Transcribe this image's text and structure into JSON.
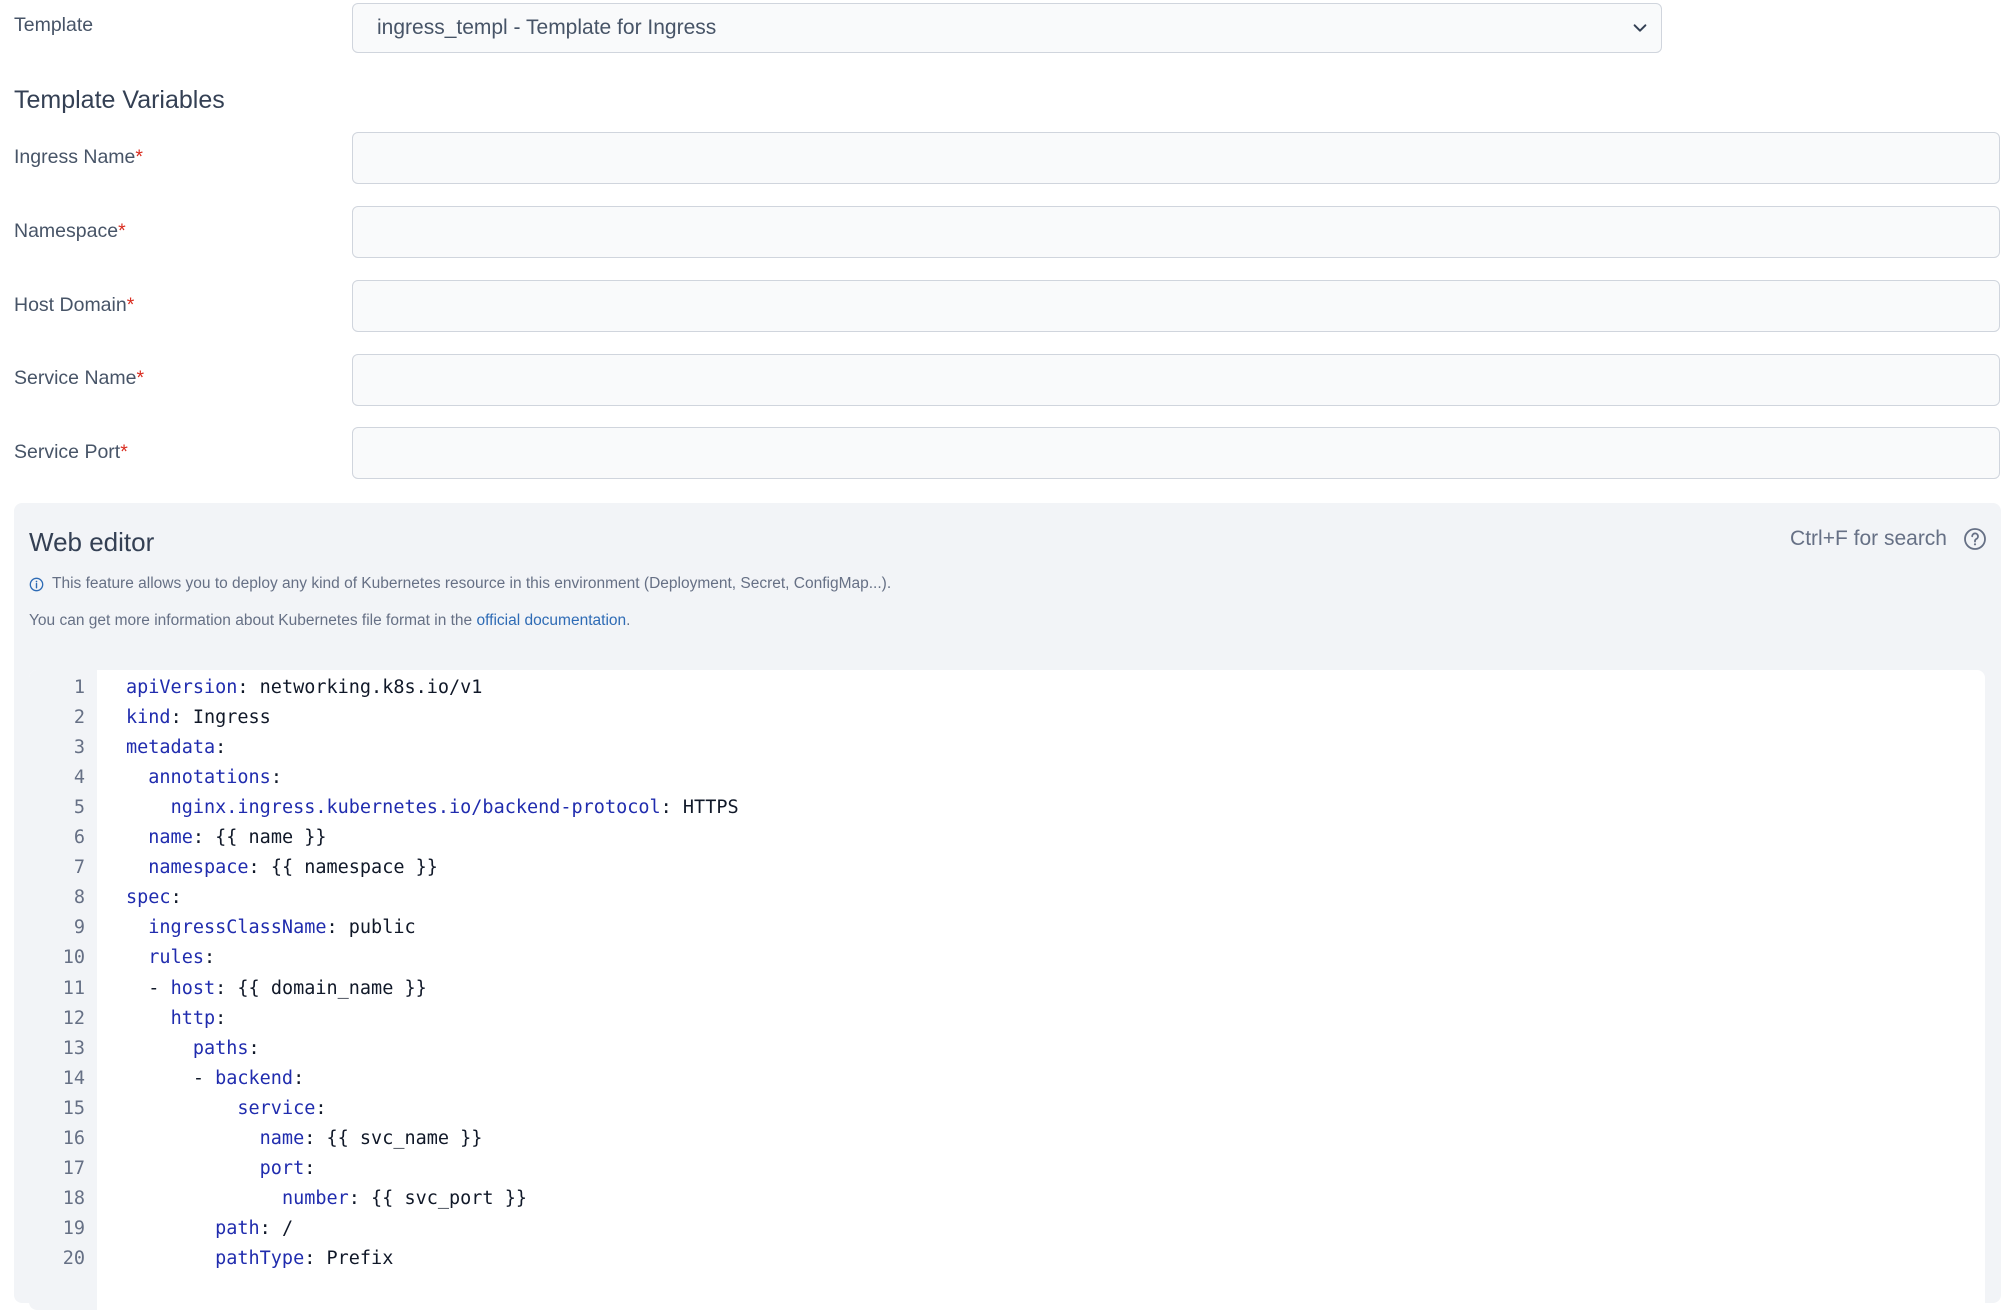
{
  "template": {
    "label": "Template",
    "selected": "ingress_templ - Template for Ingress"
  },
  "variables": {
    "title": "Template Variables",
    "fields": [
      {
        "label": "Ingress Name",
        "required": "*",
        "value": ""
      },
      {
        "label": "Namespace",
        "required": "*",
        "value": ""
      },
      {
        "label": "Host Domain",
        "required": "*",
        "value": ""
      },
      {
        "label": "Service Name",
        "required": "*",
        "value": ""
      },
      {
        "label": "Service Port",
        "required": "*",
        "value": ""
      }
    ]
  },
  "editor": {
    "title": "Web editor",
    "search_hint": "Ctrl+F for search",
    "info_text": "This feature allows you to deploy any kind of Kubernetes resource in this environment (Deployment, Secret, ConfigMap...).",
    "more_prefix": "You can get more information about Kubernetes file format in the ",
    "more_link": "official documentation",
    "more_suffix": ".",
    "lines": [
      {
        "n": "1",
        "indent": "",
        "dash": "",
        "key": "apiVersion",
        "sep": ": ",
        "value": "networking.k8s.io/v1"
      },
      {
        "n": "2",
        "indent": "",
        "dash": "",
        "key": "kind",
        "sep": ": ",
        "value": "Ingress"
      },
      {
        "n": "3",
        "indent": "",
        "dash": "",
        "key": "metadata",
        "sep": ":",
        "value": ""
      },
      {
        "n": "4",
        "indent": "  ",
        "dash": "",
        "key": "annotations",
        "sep": ":",
        "value": ""
      },
      {
        "n": "5",
        "indent": "    ",
        "dash": "",
        "key": "nginx.ingress.kubernetes.io/backend-protocol",
        "sep": ": ",
        "value": "HTTPS"
      },
      {
        "n": "6",
        "indent": "  ",
        "dash": "",
        "key": "name",
        "sep": ": ",
        "value": "{{ name }}"
      },
      {
        "n": "7",
        "indent": "  ",
        "dash": "",
        "key": "namespace",
        "sep": ": ",
        "value": "{{ namespace }}"
      },
      {
        "n": "8",
        "indent": "",
        "dash": "",
        "key": "spec",
        "sep": ":",
        "value": ""
      },
      {
        "n": "9",
        "indent": "  ",
        "dash": "",
        "key": "ingressClassName",
        "sep": ": ",
        "value": "public"
      },
      {
        "n": "10",
        "indent": "  ",
        "dash": "",
        "key": "rules",
        "sep": ":",
        "value": ""
      },
      {
        "n": "11",
        "indent": "  ",
        "dash": "- ",
        "key": "host",
        "sep": ": ",
        "value": "{{ domain_name }}"
      },
      {
        "n": "12",
        "indent": "    ",
        "dash": "",
        "key": "http",
        "sep": ":",
        "value": ""
      },
      {
        "n": "13",
        "indent": "      ",
        "dash": "",
        "key": "paths",
        "sep": ":",
        "value": ""
      },
      {
        "n": "14",
        "indent": "      ",
        "dash": "- ",
        "key": "backend",
        "sep": ":",
        "value": ""
      },
      {
        "n": "15",
        "indent": "          ",
        "dash": "",
        "key": "service",
        "sep": ":",
        "value": ""
      },
      {
        "n": "16",
        "indent": "            ",
        "dash": "",
        "key": "name",
        "sep": ": ",
        "value": "{{ svc_name }}"
      },
      {
        "n": "17",
        "indent": "            ",
        "dash": "",
        "key": "port",
        "sep": ":",
        "value": ""
      },
      {
        "n": "18",
        "indent": "              ",
        "dash": "",
        "key": "number",
        "sep": ": ",
        "value": "{{ svc_port }}"
      },
      {
        "n": "19",
        "indent": "        ",
        "dash": "",
        "key": "path",
        "sep": ": ",
        "value": "/"
      },
      {
        "n": "20",
        "indent": "        ",
        "dash": "",
        "key": "pathType",
        "sep": ": ",
        "value": "Prefix"
      }
    ]
  }
}
